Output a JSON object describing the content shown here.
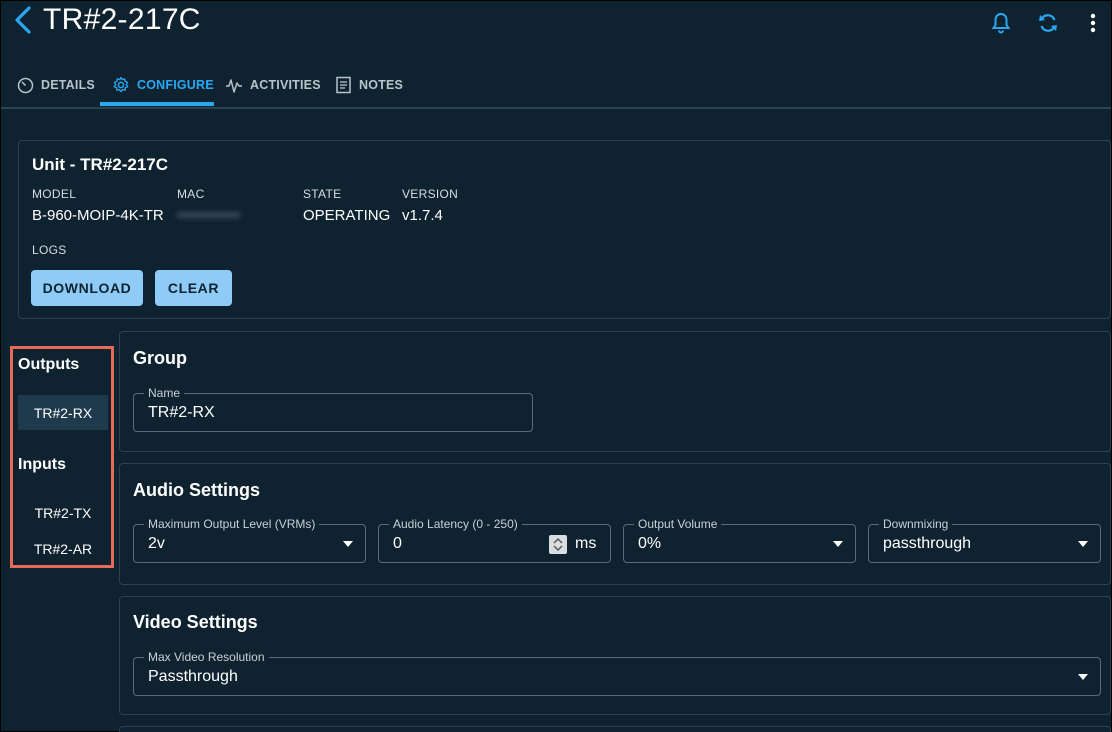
{
  "header": {
    "title": "TR#2-217C",
    "icons": [
      "back-icon",
      "bell-icon",
      "sync-icon",
      "more-vert-icon"
    ]
  },
  "tabs": [
    {
      "label": "DETAILS",
      "icon": "gauge-icon",
      "active": false
    },
    {
      "label": "CONFIGURE",
      "icon": "gear-icon",
      "active": true
    },
    {
      "label": "ACTIVITIES",
      "icon": "pulse-icon",
      "active": false
    },
    {
      "label": "NOTES",
      "icon": "notes-icon",
      "active": false
    }
  ],
  "unit": {
    "title": "Unit - TR#2-217C",
    "model_label": "MODEL",
    "model": "B-960-MOIP-4K-TR",
    "mac_label": "MAC",
    "mac": "••••••••••••",
    "state_label": "STATE",
    "state": "OPERATING",
    "version_label": "VERSION",
    "version": "v1.7.4",
    "logs_label": "LOGS",
    "download_label": "DOWNLOAD",
    "clear_label": "CLEAR"
  },
  "sidebar": {
    "outputs_heading": "Outputs",
    "outputs": [
      {
        "label": "TR#2-RX",
        "selected": true
      }
    ],
    "inputs_heading": "Inputs",
    "inputs": [
      {
        "label": "TR#2-TX"
      },
      {
        "label": "TR#2-AR"
      }
    ]
  },
  "group": {
    "title": "Group",
    "name_label": "Name",
    "name_value": "TR#2-RX"
  },
  "audio": {
    "title": "Audio Settings",
    "max_output_label": "Maximum Output Level (VRMs)",
    "max_output_value": "2v",
    "latency_label": "Audio Latency (0 - 250)",
    "latency_value": "0",
    "latency_unit": "ms",
    "volume_label": "Output Volume",
    "volume_value": "0%",
    "downmix_label": "Downmixing",
    "downmix_value": "passthrough"
  },
  "video": {
    "title": "Video Settings",
    "max_res_label": "Max Video Resolution",
    "max_res_value": "Passthrough"
  },
  "colors": {
    "background": "#0f2230",
    "accent": "#29a8f2",
    "button": "#8ecbf6",
    "highlight_border": "#e8685a"
  }
}
